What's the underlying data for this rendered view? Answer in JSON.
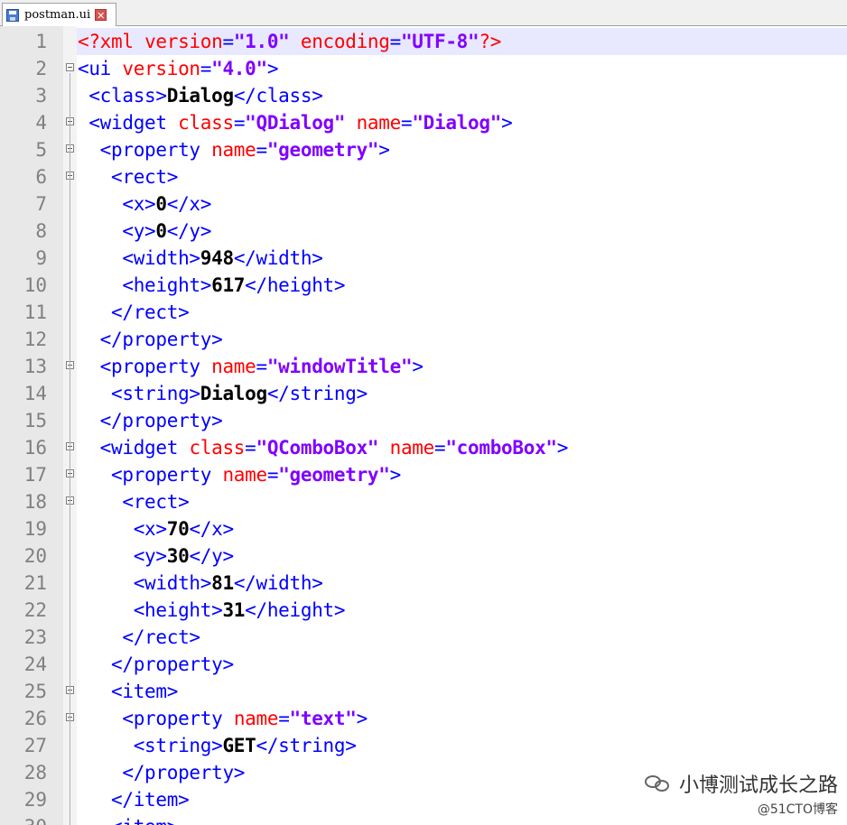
{
  "tab": {
    "title": "postman.ui",
    "close_glyph": "✕",
    "icon": "save-icon"
  },
  "lines": [
    [
      [
        "p",
        "<?xml "
      ],
      [
        "a",
        "version"
      ],
      [
        "t",
        "="
      ],
      [
        "s",
        "\"1.0\""
      ],
      [
        "t",
        " "
      ],
      [
        "a",
        "encoding"
      ],
      [
        "t",
        "="
      ],
      [
        "s",
        "\"UTF-8\""
      ],
      [
        "p",
        "?>"
      ]
    ],
    [
      [
        "t",
        "<ui "
      ],
      [
        "a",
        "version"
      ],
      [
        "t",
        "="
      ],
      [
        "s",
        "\"4.0\""
      ],
      [
        "t",
        ">"
      ]
    ],
    [
      [
        "t",
        " <class>"
      ],
      [
        "b",
        "Dialog"
      ],
      [
        "t",
        "</class>"
      ]
    ],
    [
      [
        "t",
        " <widget "
      ],
      [
        "a",
        "class"
      ],
      [
        "t",
        "="
      ],
      [
        "s",
        "\"QDialog\""
      ],
      [
        "t",
        " "
      ],
      [
        "a",
        "name"
      ],
      [
        "t",
        "="
      ],
      [
        "s",
        "\"Dialog\""
      ],
      [
        "t",
        ">"
      ]
    ],
    [
      [
        "t",
        "  <property "
      ],
      [
        "a",
        "name"
      ],
      [
        "t",
        "="
      ],
      [
        "s",
        "\"geometry\""
      ],
      [
        "t",
        ">"
      ]
    ],
    [
      [
        "t",
        "   <rect>"
      ]
    ],
    [
      [
        "t",
        "    <x>"
      ],
      [
        "b",
        "0"
      ],
      [
        "t",
        "</x>"
      ]
    ],
    [
      [
        "t",
        "    <y>"
      ],
      [
        "b",
        "0"
      ],
      [
        "t",
        "</y>"
      ]
    ],
    [
      [
        "t",
        "    <width>"
      ],
      [
        "b",
        "948"
      ],
      [
        "t",
        "</width>"
      ]
    ],
    [
      [
        "t",
        "    <height>"
      ],
      [
        "b",
        "617"
      ],
      [
        "t",
        "</height>"
      ]
    ],
    [
      [
        "t",
        "   </rect>"
      ]
    ],
    [
      [
        "t",
        "  </property>"
      ]
    ],
    [
      [
        "t",
        "  <property "
      ],
      [
        "a",
        "name"
      ],
      [
        "t",
        "="
      ],
      [
        "s",
        "\"windowTitle\""
      ],
      [
        "t",
        ">"
      ]
    ],
    [
      [
        "t",
        "   <string>"
      ],
      [
        "b",
        "Dialog"
      ],
      [
        "t",
        "</string>"
      ]
    ],
    [
      [
        "t",
        "  </property>"
      ]
    ],
    [
      [
        "t",
        "  <widget "
      ],
      [
        "a",
        "class"
      ],
      [
        "t",
        "="
      ],
      [
        "s",
        "\"QComboBox\""
      ],
      [
        "t",
        " "
      ],
      [
        "a",
        "name"
      ],
      [
        "t",
        "="
      ],
      [
        "s",
        "\"comboBox\""
      ],
      [
        "t",
        ">"
      ]
    ],
    [
      [
        "t",
        "   <property "
      ],
      [
        "a",
        "name"
      ],
      [
        "t",
        "="
      ],
      [
        "s",
        "\"geometry\""
      ],
      [
        "t",
        ">"
      ]
    ],
    [
      [
        "t",
        "    <rect>"
      ]
    ],
    [
      [
        "t",
        "     <x>"
      ],
      [
        "b",
        "70"
      ],
      [
        "t",
        "</x>"
      ]
    ],
    [
      [
        "t",
        "     <y>"
      ],
      [
        "b",
        "30"
      ],
      [
        "t",
        "</y>"
      ]
    ],
    [
      [
        "t",
        "     <width>"
      ],
      [
        "b",
        "81"
      ],
      [
        "t",
        "</width>"
      ]
    ],
    [
      [
        "t",
        "     <height>"
      ],
      [
        "b",
        "31"
      ],
      [
        "t",
        "</height>"
      ]
    ],
    [
      [
        "t",
        "    </rect>"
      ]
    ],
    [
      [
        "t",
        "   </property>"
      ]
    ],
    [
      [
        "t",
        "   <item>"
      ]
    ],
    [
      [
        "t",
        "    <property "
      ],
      [
        "a",
        "name"
      ],
      [
        "t",
        "="
      ],
      [
        "s",
        "\"text\""
      ],
      [
        "t",
        ">"
      ]
    ],
    [
      [
        "t",
        "     <string>"
      ],
      [
        "b",
        "GET"
      ],
      [
        "t",
        "</string>"
      ]
    ],
    [
      [
        "t",
        "    </property>"
      ]
    ],
    [
      [
        "t",
        "   </item>"
      ]
    ],
    [
      [
        "t",
        "   <item>"
      ]
    ]
  ],
  "watermark": {
    "line1": "小博测试成长之路",
    "line2": "@51CTO博客",
    "icon": "wechat-icon"
  }
}
